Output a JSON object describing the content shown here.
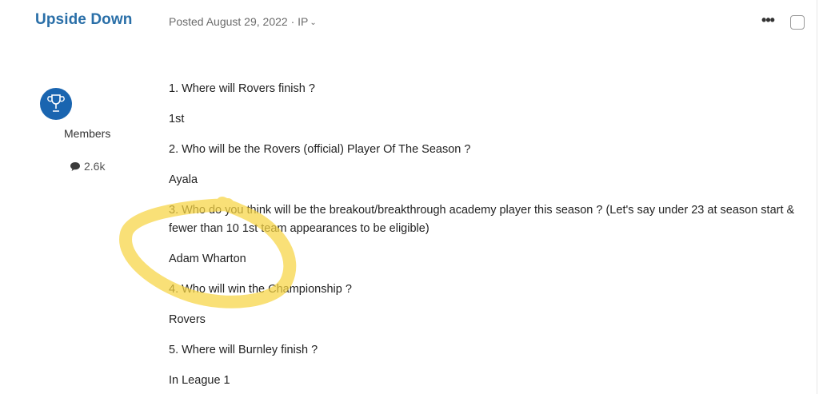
{
  "post": {
    "author": "Upside Down",
    "posted_label": "Posted August 29, 2022",
    "separator": "·",
    "ip_label": "IP",
    "more_icon": "ellipsis-icon"
  },
  "author_info": {
    "group": "Members",
    "post_count": "2.6k",
    "avatar_icon": "trophy-icon",
    "post_count_icon": "speech-bubble-icon"
  },
  "content": {
    "lines": [
      "1. Where will Rovers finish ?",
      "1st",
      "2. Who will be the Rovers (official) Player Of The Season ?",
      "Ayala",
      "3. Who do you think will be the breakout/breakthrough academy player this season ? (Let's say under 23 at season start & fewer than 10 1st team appearances to be eligible)",
      "Adam Wharton",
      "4. Who will win the Championship ?",
      "Rovers",
      "5. Where will Burnley finish ?",
      "In League 1"
    ]
  },
  "colors": {
    "author": "#2a6fa8",
    "avatar_bg": "#1a65b0",
    "highlight": "#f7d443"
  }
}
